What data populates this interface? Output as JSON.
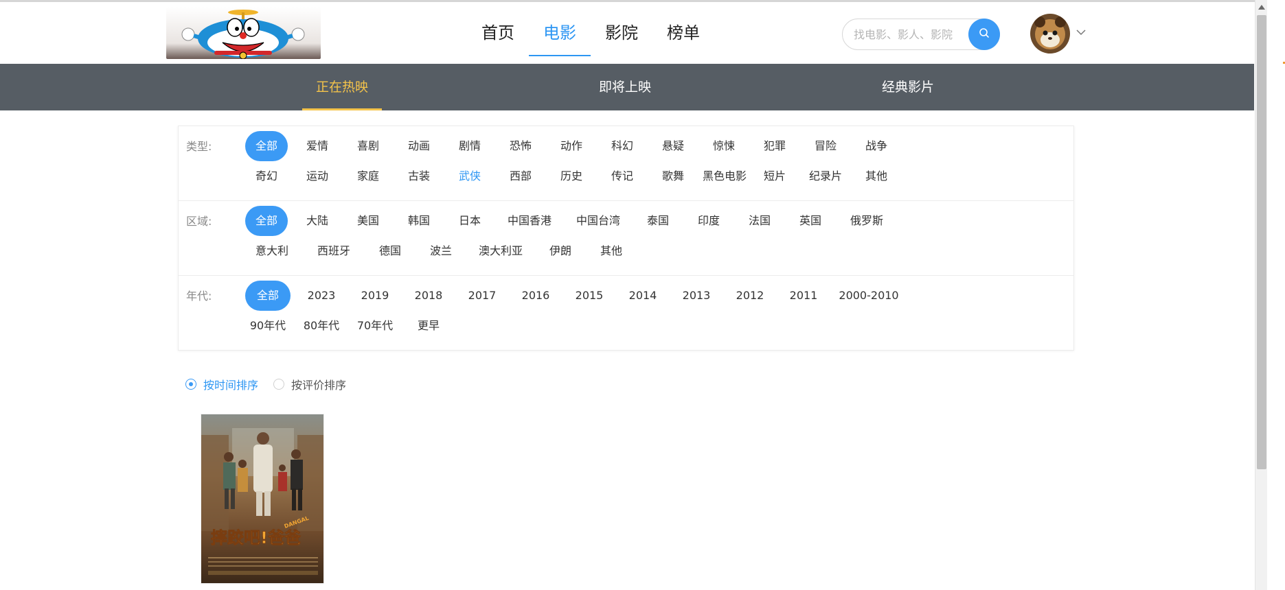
{
  "header": {
    "nav": [
      {
        "label": "首页",
        "active": false
      },
      {
        "label": "电影",
        "active": true
      },
      {
        "label": "影院",
        "active": false
      },
      {
        "label": "榜单",
        "active": false
      }
    ],
    "search": {
      "placeholder": "找电影、影人、影院"
    },
    "colors": {
      "accent": "#2d96f3",
      "button": "#3b9af5"
    }
  },
  "subnav": {
    "items": [
      {
        "label": "正在热映",
        "active": true
      },
      {
        "label": "即将上映",
        "active": false
      },
      {
        "label": "经典影片",
        "active": false
      }
    ],
    "colors": {
      "background": "#565d64",
      "active": "#f4c34a"
    }
  },
  "filters": {
    "type": {
      "label": "类型:",
      "rows": [
        [
          "全部",
          "爱情",
          "喜剧",
          "动画",
          "剧情",
          "恐怖",
          "动作",
          "科幻",
          "悬疑",
          "惊悚",
          "犯罪",
          "冒险",
          "战争"
        ],
        [
          "奇幻",
          "运动",
          "家庭",
          "古装",
          "武侠",
          "西部",
          "历史",
          "传记",
          "歌舞",
          "黑色电影",
          "短片",
          "纪录片",
          "其他"
        ]
      ],
      "selected": "全部",
      "hover": "武侠"
    },
    "region": {
      "label": "区域:",
      "rows": [
        [
          "全部",
          "大陆",
          "美国",
          "韩国",
          "日本",
          "中国香港",
          "中国台湾",
          "泰国",
          "印度",
          "法国",
          "英国",
          "俄罗斯"
        ],
        [
          "意大利",
          "西班牙",
          "德国",
          "波兰",
          "澳大利亚",
          "伊朗",
          "其他"
        ]
      ],
      "selected": "全部"
    },
    "year": {
      "label": "年代:",
      "rows": [
        [
          "全部",
          "2023",
          "2019",
          "2018",
          "2017",
          "2016",
          "2015",
          "2014",
          "2013",
          "2012",
          "2011",
          "2000-2010"
        ],
        [
          "90年代",
          "80年代",
          "70年代",
          "更早"
        ]
      ],
      "selected": "全部"
    }
  },
  "sort": {
    "options": [
      {
        "label": "按时间排序",
        "checked": true
      },
      {
        "label": "按评价排序",
        "checked": false
      }
    ]
  },
  "movies": [
    {
      "poster_text": "摔跤吧!爸爸",
      "poster_sub": "DANGAL"
    }
  ],
  "icons": {
    "search": "search-icon",
    "caret": "chevron-down-icon"
  }
}
